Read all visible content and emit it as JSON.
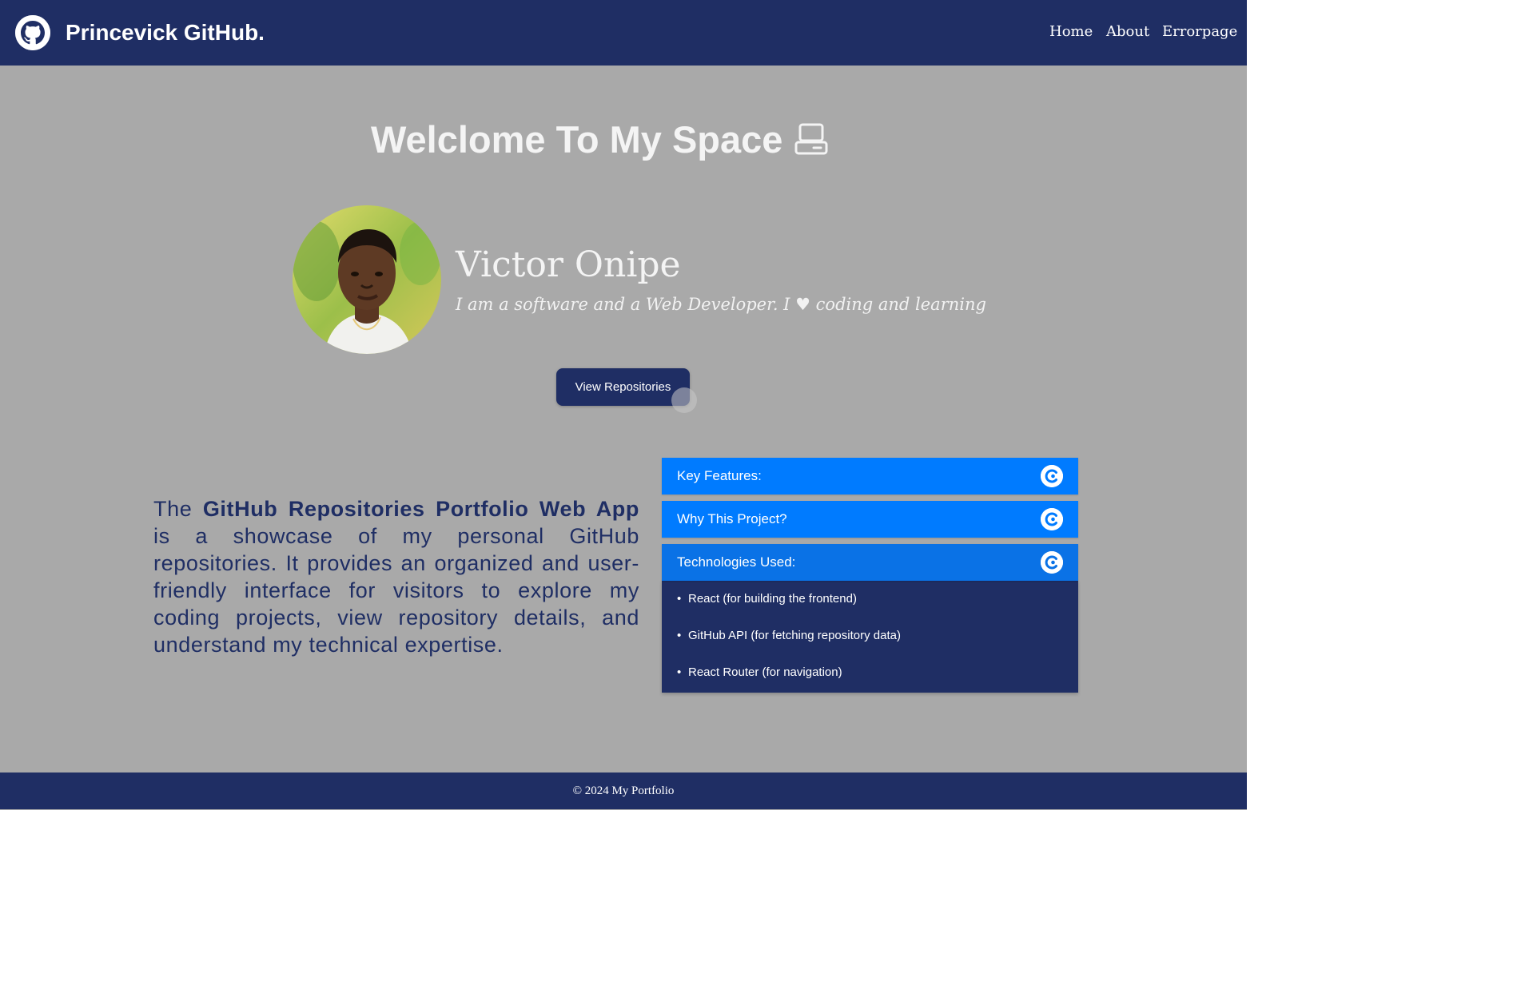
{
  "navbar": {
    "brand": "Princevick GitHub.",
    "brand_icon": "github-icon",
    "links": [
      "Home",
      "About",
      "Errorpage"
    ]
  },
  "hero": {
    "welcome": "Welclome To My Space",
    "welcome_icon": "laptop-icon",
    "name": "Victor Onipe",
    "tagline": "I am a software and a Web Developer. I ♥ coding and learning",
    "button_label": "View Repositories"
  },
  "about": {
    "prefix": "The",
    "strong": "GitHub Repositories Portfolio Web App",
    "rest": "is a showcase of my personal GitHub repositories. It provides an organized and user-friendly interface for visitors to explore my coding projects, view repository details, and understand my technical expertise."
  },
  "accordion": {
    "sections": [
      {
        "title": "Key Features:"
      },
      {
        "title": "Why This Project?"
      },
      {
        "title": "Technologies Used:",
        "items": [
          "React (for building the frontend)",
          "GitHub API (for fetching repository data)",
          "React Router (for navigation)"
        ]
      }
    ],
    "bullet": "•"
  },
  "footer": {
    "text": "© 2024 My Portfolio"
  },
  "colors": {
    "navy": "#1f2e64",
    "accent_blue": "#007bff",
    "background": "#a9a9a9"
  }
}
